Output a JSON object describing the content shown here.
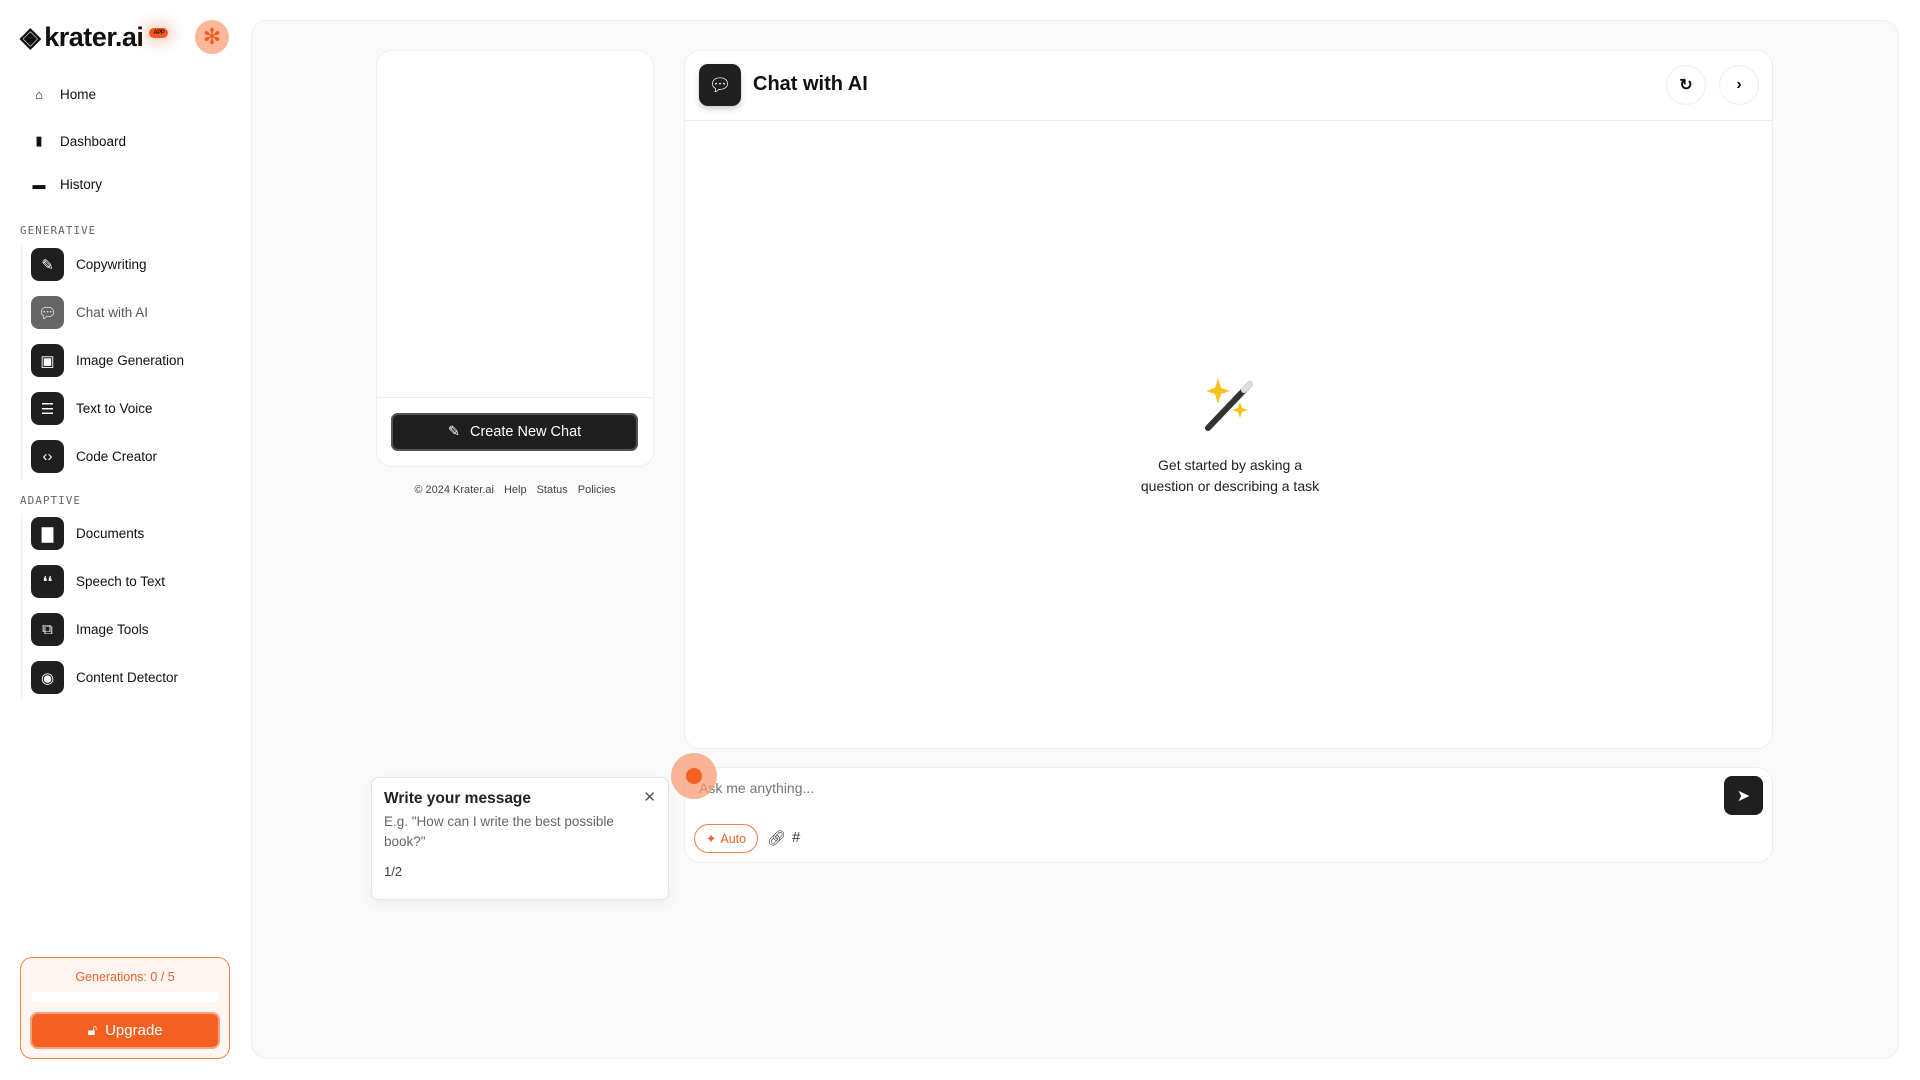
{
  "brand": {
    "name": "krater.ai",
    "badge": "APP"
  },
  "nav": [
    {
      "label": "Home",
      "icon": "home-icon"
    },
    {
      "label": "Dashboard",
      "icon": "bar-chart-icon"
    },
    {
      "label": "History",
      "icon": "folder-icon"
    }
  ],
  "sections": {
    "generative": "GENERATIVE",
    "adaptive": "ADAPTIVE"
  },
  "generative": [
    {
      "label": "Copywriting",
      "icon": "pencil-icon"
    },
    {
      "label": "Chat with AI",
      "icon": "chat-bubble-icon",
      "active": true
    },
    {
      "label": "Image Generation",
      "icon": "image-icon"
    },
    {
      "label": "Text to Voice",
      "icon": "microphone-icon"
    },
    {
      "label": "Code Creator",
      "icon": "code-icon"
    }
  ],
  "adaptive": [
    {
      "label": "Documents",
      "icon": "document-icon"
    },
    {
      "label": "Speech to Text",
      "icon": "quote-icon"
    },
    {
      "label": "Image Tools",
      "icon": "images-icon"
    },
    {
      "label": "Content Detector",
      "icon": "eye-slash-icon"
    }
  ],
  "usage": {
    "label": "Generations: 0 / 5",
    "used": 0,
    "limit": 5,
    "upgrade": "Upgrade"
  },
  "chatlist": {
    "create": "Create New Chat"
  },
  "footer": {
    "copyright": "© 2024 Krater.ai",
    "links": [
      "Help",
      "Status",
      "Policies"
    ]
  },
  "chat": {
    "title": "Chat with AI",
    "empty_line1": "Get started by asking a",
    "empty_line2": "question or describing a task"
  },
  "input": {
    "placeholder": "Ask me anything...",
    "value": "",
    "auto": "Auto"
  },
  "tooltip": {
    "title": "Write your message",
    "body": "E.g. \"How can I write the best possible book?\"",
    "step": "1/2"
  },
  "colors": {
    "accent": "#f45f22",
    "dark": "#1f1f1f"
  }
}
